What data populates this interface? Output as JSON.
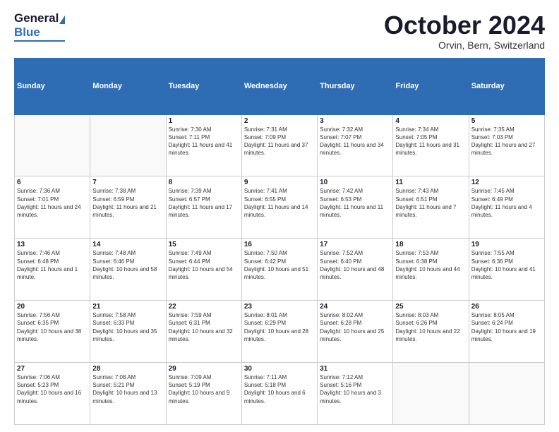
{
  "header": {
    "logo_general": "General",
    "logo_blue": "Blue",
    "month_title": "October 2024",
    "subtitle": "Orvin, Bern, Switzerland"
  },
  "weekdays": [
    "Sunday",
    "Monday",
    "Tuesday",
    "Wednesday",
    "Thursday",
    "Friday",
    "Saturday"
  ],
  "weeks": [
    [
      {
        "day": "",
        "sunrise": "",
        "sunset": "",
        "daylight": ""
      },
      {
        "day": "",
        "sunrise": "",
        "sunset": "",
        "daylight": ""
      },
      {
        "day": "1",
        "sunrise": "Sunrise: 7:30 AM",
        "sunset": "Sunset: 7:11 PM",
        "daylight": "Daylight: 11 hours and 41 minutes."
      },
      {
        "day": "2",
        "sunrise": "Sunrise: 7:31 AM",
        "sunset": "Sunset: 7:09 PM",
        "daylight": "Daylight: 11 hours and 37 minutes."
      },
      {
        "day": "3",
        "sunrise": "Sunrise: 7:32 AM",
        "sunset": "Sunset: 7:07 PM",
        "daylight": "Daylight: 11 hours and 34 minutes."
      },
      {
        "day": "4",
        "sunrise": "Sunrise: 7:34 AM",
        "sunset": "Sunset: 7:05 PM",
        "daylight": "Daylight: 11 hours and 31 minutes."
      },
      {
        "day": "5",
        "sunrise": "Sunrise: 7:35 AM",
        "sunset": "Sunset: 7:03 PM",
        "daylight": "Daylight: 11 hours and 27 minutes."
      }
    ],
    [
      {
        "day": "6",
        "sunrise": "Sunrise: 7:36 AM",
        "sunset": "Sunset: 7:01 PM",
        "daylight": "Daylight: 11 hours and 24 minutes."
      },
      {
        "day": "7",
        "sunrise": "Sunrise: 7:38 AM",
        "sunset": "Sunset: 6:59 PM",
        "daylight": "Daylight: 11 hours and 21 minutes."
      },
      {
        "day": "8",
        "sunrise": "Sunrise: 7:39 AM",
        "sunset": "Sunset: 6:57 PM",
        "daylight": "Daylight: 11 hours and 17 minutes."
      },
      {
        "day": "9",
        "sunrise": "Sunrise: 7:41 AM",
        "sunset": "Sunset: 6:55 PM",
        "daylight": "Daylight: 11 hours and 14 minutes."
      },
      {
        "day": "10",
        "sunrise": "Sunrise: 7:42 AM",
        "sunset": "Sunset: 6:53 PM",
        "daylight": "Daylight: 11 hours and 11 minutes."
      },
      {
        "day": "11",
        "sunrise": "Sunrise: 7:43 AM",
        "sunset": "Sunset: 6:51 PM",
        "daylight": "Daylight: 11 hours and 7 minutes."
      },
      {
        "day": "12",
        "sunrise": "Sunrise: 7:45 AM",
        "sunset": "Sunset: 6:49 PM",
        "daylight": "Daylight: 11 hours and 4 minutes."
      }
    ],
    [
      {
        "day": "13",
        "sunrise": "Sunrise: 7:46 AM",
        "sunset": "Sunset: 6:48 PM",
        "daylight": "Daylight: 11 hours and 1 minute."
      },
      {
        "day": "14",
        "sunrise": "Sunrise: 7:48 AM",
        "sunset": "Sunset: 6:46 PM",
        "daylight": "Daylight: 10 hours and 58 minutes."
      },
      {
        "day": "15",
        "sunrise": "Sunrise: 7:49 AM",
        "sunset": "Sunset: 6:44 PM",
        "daylight": "Daylight: 10 hours and 54 minutes."
      },
      {
        "day": "16",
        "sunrise": "Sunrise: 7:50 AM",
        "sunset": "Sunset: 6:42 PM",
        "daylight": "Daylight: 10 hours and 51 minutes."
      },
      {
        "day": "17",
        "sunrise": "Sunrise: 7:52 AM",
        "sunset": "Sunset: 6:40 PM",
        "daylight": "Daylight: 10 hours and 48 minutes."
      },
      {
        "day": "18",
        "sunrise": "Sunrise: 7:53 AM",
        "sunset": "Sunset: 6:38 PM",
        "daylight": "Daylight: 10 hours and 44 minutes."
      },
      {
        "day": "19",
        "sunrise": "Sunrise: 7:55 AM",
        "sunset": "Sunset: 6:36 PM",
        "daylight": "Daylight: 10 hours and 41 minutes."
      }
    ],
    [
      {
        "day": "20",
        "sunrise": "Sunrise: 7:56 AM",
        "sunset": "Sunset: 6:35 PM",
        "daylight": "Daylight: 10 hours and 38 minutes."
      },
      {
        "day": "21",
        "sunrise": "Sunrise: 7:58 AM",
        "sunset": "Sunset: 6:33 PM",
        "daylight": "Daylight: 10 hours and 35 minutes."
      },
      {
        "day": "22",
        "sunrise": "Sunrise: 7:59 AM",
        "sunset": "Sunset: 6:31 PM",
        "daylight": "Daylight: 10 hours and 32 minutes."
      },
      {
        "day": "23",
        "sunrise": "Sunrise: 8:01 AM",
        "sunset": "Sunset: 6:29 PM",
        "daylight": "Daylight: 10 hours and 28 minutes."
      },
      {
        "day": "24",
        "sunrise": "Sunrise: 8:02 AM",
        "sunset": "Sunset: 6:28 PM",
        "daylight": "Daylight: 10 hours and 25 minutes."
      },
      {
        "day": "25",
        "sunrise": "Sunrise: 8:03 AM",
        "sunset": "Sunset: 6:26 PM",
        "daylight": "Daylight: 10 hours and 22 minutes."
      },
      {
        "day": "26",
        "sunrise": "Sunrise: 8:05 AM",
        "sunset": "Sunset: 6:24 PM",
        "daylight": "Daylight: 10 hours and 19 minutes."
      }
    ],
    [
      {
        "day": "27",
        "sunrise": "Sunrise: 7:06 AM",
        "sunset": "Sunset: 5:23 PM",
        "daylight": "Daylight: 10 hours and 16 minutes."
      },
      {
        "day": "28",
        "sunrise": "Sunrise: 7:08 AM",
        "sunset": "Sunset: 5:21 PM",
        "daylight": "Daylight: 10 hours and 13 minutes."
      },
      {
        "day": "29",
        "sunrise": "Sunrise: 7:09 AM",
        "sunset": "Sunset: 5:19 PM",
        "daylight": "Daylight: 10 hours and 9 minutes."
      },
      {
        "day": "30",
        "sunrise": "Sunrise: 7:11 AM",
        "sunset": "Sunset: 5:18 PM",
        "daylight": "Daylight: 10 hours and 6 minutes."
      },
      {
        "day": "31",
        "sunrise": "Sunrise: 7:12 AM",
        "sunset": "Sunset: 5:16 PM",
        "daylight": "Daylight: 10 hours and 3 minutes."
      },
      {
        "day": "",
        "sunrise": "",
        "sunset": "",
        "daylight": ""
      },
      {
        "day": "",
        "sunrise": "",
        "sunset": "",
        "daylight": ""
      }
    ]
  ]
}
